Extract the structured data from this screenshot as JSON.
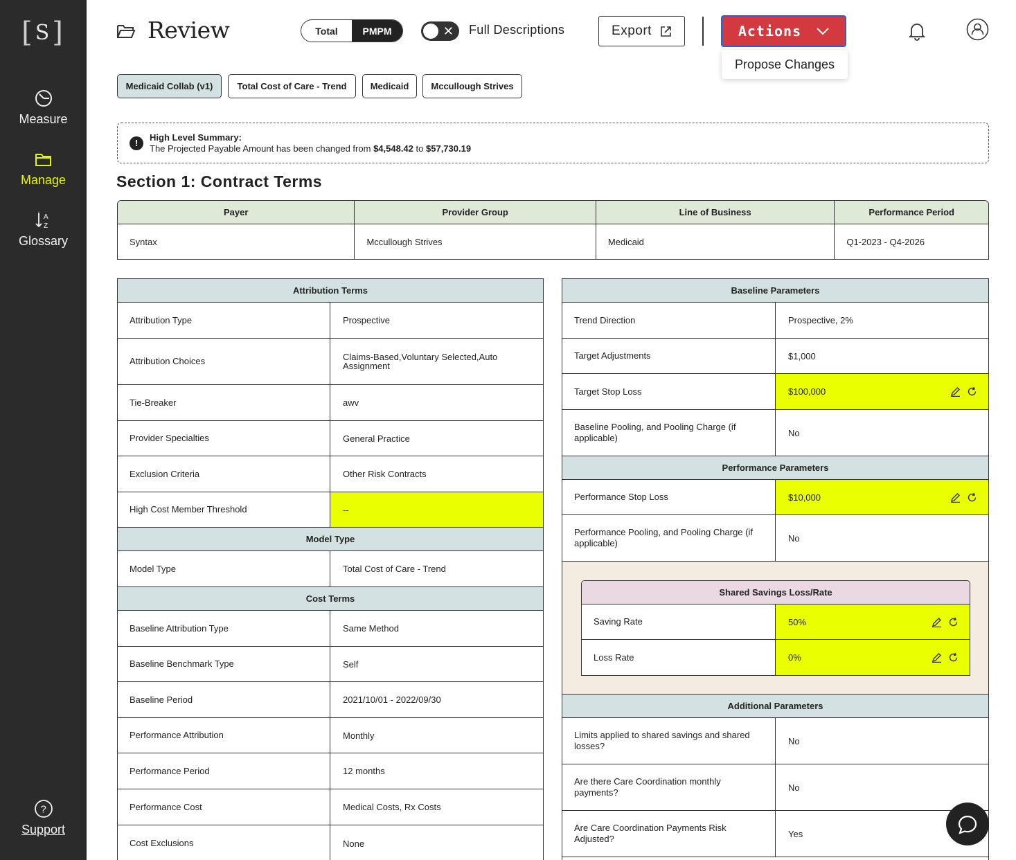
{
  "app": {
    "logo_letter": "S"
  },
  "sidebar": {
    "items": [
      {
        "label": "Measure",
        "icon": "measure-icon"
      },
      {
        "label": "Manage",
        "icon": "folder-icon",
        "active": true
      },
      {
        "label": "Glossary",
        "icon": "sort-az-icon"
      }
    ],
    "support_label": "Support",
    "support_icon": "help-icon"
  },
  "header": {
    "title": "Review",
    "title_icon": "folder-open-icon",
    "segment": {
      "options": [
        "Total",
        "PMPM"
      ],
      "selected": "PMPM"
    },
    "toggle_label": "Full Descriptions",
    "export_label": "Export",
    "actions_label": "Actions",
    "actions_menu": [
      "Propose Changes"
    ]
  },
  "chips": [
    {
      "label": "Medicaid Collab (v1)",
      "selected": true
    },
    {
      "label": "Total Cost of Care - Trend"
    },
    {
      "label": "Medicaid"
    },
    {
      "label": "Mccullough Strives"
    }
  ],
  "summary": {
    "title": "High Level Summary:",
    "text_prefix": "The Projected Payable Amount has been changed from",
    "from": "$4,548.42",
    "mid": "to",
    "to": "$57,730.19"
  },
  "section_title": "Section 1: Contract Terms",
  "contract_terms": {
    "headers": [
      "Payer",
      "Provider Group",
      "Line of Business",
      "Performance Period"
    ],
    "values": [
      "Syntax",
      "Mccullough Strives",
      "Medicaid",
      "Q1-2023 - Q4-2026"
    ]
  },
  "left_panel": {
    "attribution": {
      "title": "Attribution Terms",
      "rows": [
        {
          "k": "Attribution Type",
          "v": "Prospective"
        },
        {
          "k": "Attribution Choices",
          "v": "Claims-Based,Voluntary Selected,Auto Assignment"
        },
        {
          "k": "Tie-Breaker",
          "v": "awv"
        },
        {
          "k": "Provider Specialties",
          "v": "General Practice"
        },
        {
          "k": "Exclusion Criteria",
          "v": "Other Risk Contracts"
        },
        {
          "k": "High Cost Member Threshold",
          "v": "--",
          "highlight": true
        }
      ]
    },
    "model": {
      "title": "Model Type",
      "rows": [
        {
          "k": "Model Type",
          "v": "Total Cost of Care - Trend"
        }
      ]
    },
    "cost": {
      "title": "Cost Terms",
      "rows": [
        {
          "k": "Baseline Attribution Type",
          "v": "Same Method"
        },
        {
          "k": "Baseline Benchmark Type",
          "v": "Self"
        },
        {
          "k": "Baseline Period",
          "v": "2021/10/01 - 2022/09/30"
        },
        {
          "k": "Performance Attribution",
          "v": "Monthly"
        },
        {
          "k": "Performance Period",
          "v": "12 months"
        },
        {
          "k": "Performance Cost",
          "v": "Medical Costs, Rx Costs"
        },
        {
          "k": "Cost Exclusions",
          "v": "None"
        }
      ]
    }
  },
  "right_panel": {
    "baseline": {
      "title": "Baseline Parameters",
      "rows": [
        {
          "k": "Trend Direction",
          "v": "Prospective, 2%"
        },
        {
          "k": "Target Adjustments",
          "v": "$1,000"
        },
        {
          "k": "Target Stop Loss",
          "v": "$100,000",
          "highlight": true,
          "editable": true
        },
        {
          "k": "Baseline Pooling, and Pooling Charge (if applicable)",
          "v": "No"
        }
      ]
    },
    "performance": {
      "title": "Performance Parameters",
      "rows": [
        {
          "k": "Performance Stop Loss",
          "v": "$10,000",
          "highlight": true,
          "editable": true
        },
        {
          "k": "Performance Pooling, and Pooling Charge (if applicable)",
          "v": "No"
        }
      ]
    },
    "shared_savings": {
      "title": "Shared Savings Loss/Rate",
      "rows": [
        {
          "k": "Saving Rate",
          "v": "50%",
          "highlight": true,
          "editable": true
        },
        {
          "k": "Loss Rate",
          "v": "0%",
          "highlight": true,
          "editable": true
        }
      ]
    },
    "additional": {
      "title": "Additional Parameters",
      "rows": [
        {
          "k": "Limits applied to shared savings and shared losses?",
          "v": "No"
        },
        {
          "k": "Are there Care Coordination monthly payments?",
          "v": "No"
        },
        {
          "k": "Are Care Coordination Payments Risk Adjusted?",
          "v": "Yes"
        }
      ]
    }
  },
  "colors": {
    "sidebar_bg": "#2b2b2b",
    "active_nav": "#e8f500",
    "actions_bg": "#d33a3f",
    "highlight": "#eaff00",
    "panel_header": "#d4e1e3",
    "contract_header": "#dfe9d8",
    "shared_savings_header": "#ead8e2",
    "shared_savings_bg": "#f4ece0"
  }
}
